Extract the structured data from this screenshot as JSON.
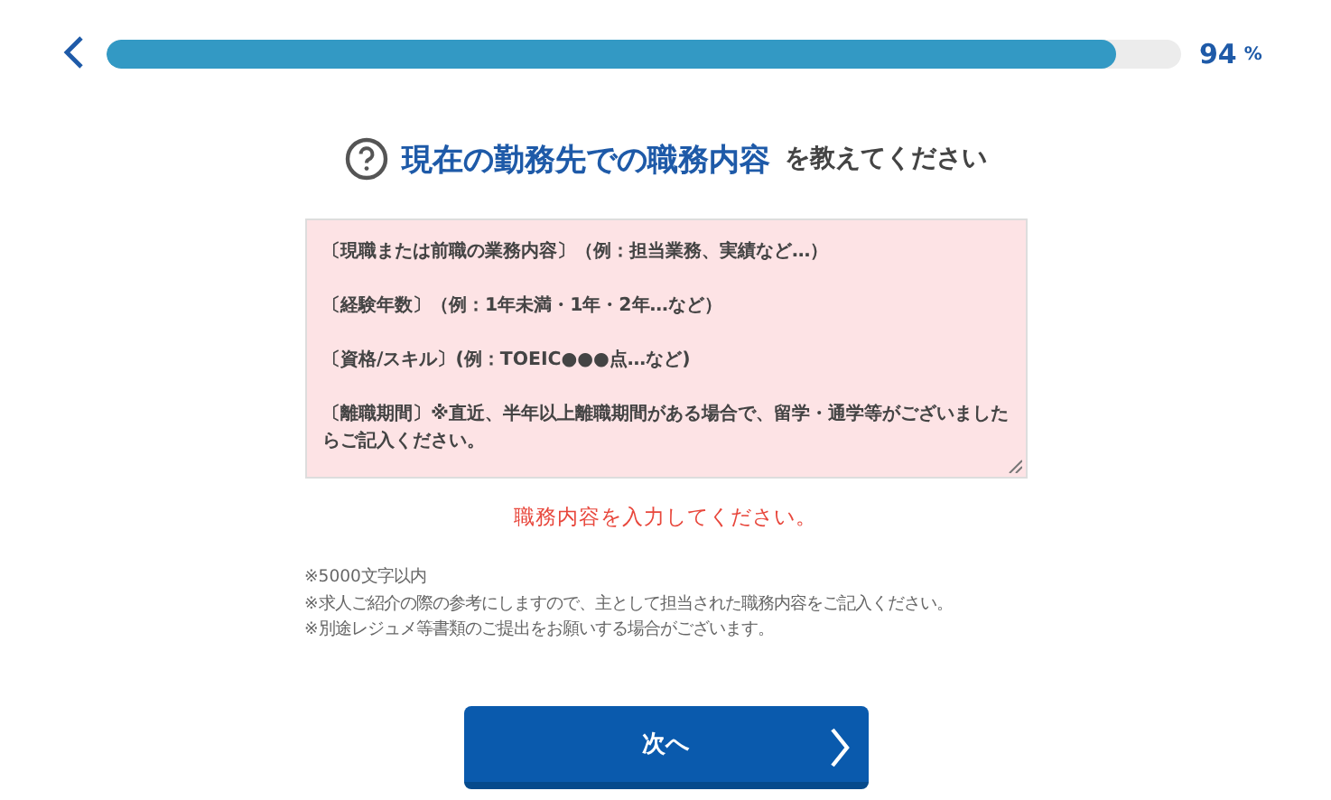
{
  "progress": {
    "level": 0.94,
    "percent": "94",
    "unit": "%"
  },
  "question": {
    "highlight": "現在の勤務先での職務内容",
    "rest": "を教えてください"
  },
  "answer": {
    "placeholder": [
      "〔現職または前職の業務内容〕（例：担当業務、実績など…）",
      "〔経験年数〕（例：1年未満・1年・2年…など）",
      "〔資格/スキル〕(例：TOEIC●●●点…など)",
      "〔離職期間〕※直近、半年以上離職期間がある場合で、留学・通学等がございましたらご記入ください。"
    ],
    "invalid": true
  },
  "error": "職務内容を入力してください。",
  "notes": [
    "※5000文字以内",
    "※求人ご紹介の際の参考にしますので、主として担当された職務内容をご記入ください。",
    "※別途レジュメ等書類のご提出をお願いする場合がございます。"
  ],
  "next_button": "次へ"
}
